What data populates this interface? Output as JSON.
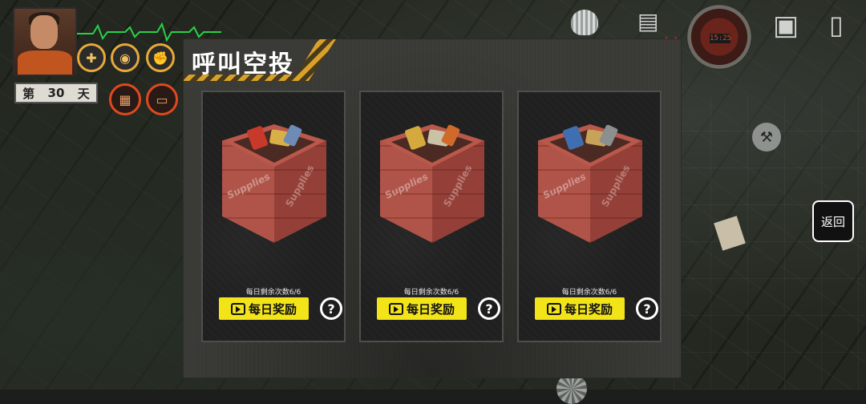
{
  "hud": {
    "day_prefix": "第",
    "day_number": "30",
    "day_suffix": "天",
    "clock_time": "15:25"
  },
  "modal": {
    "title": "呼叫空投",
    "cards": [
      {
        "crate_label": "Supplies",
        "remaining": "每日剩余次数6/6",
        "button_label": "每日奖励",
        "help": "?"
      },
      {
        "crate_label": "Supplies",
        "remaining": "每日剩余次数6/6",
        "button_label": "每日奖励",
        "help": "?"
      },
      {
        "crate_label": "Supplies",
        "remaining": "每日剩余次数6/6",
        "button_label": "每日奖励",
        "help": "?"
      }
    ]
  },
  "back_button": {
    "label": "返回"
  },
  "colors": {
    "accent_yellow": "#f3e41a",
    "hud_orange": "#e7a93a",
    "crate_red": "#b0544a",
    "warning_red": "#e01d1d"
  },
  "icons": [
    "avatar",
    "ekg-line-icon",
    "bandage-icon",
    "eye-icon",
    "fist-icon",
    "fence-icon",
    "car-icon",
    "shell-icon",
    "notes-icon",
    "clock-icon",
    "backpack-icon",
    "exit-door-icon",
    "wrench-icon",
    "tv-play-icon",
    "help-icon"
  ]
}
